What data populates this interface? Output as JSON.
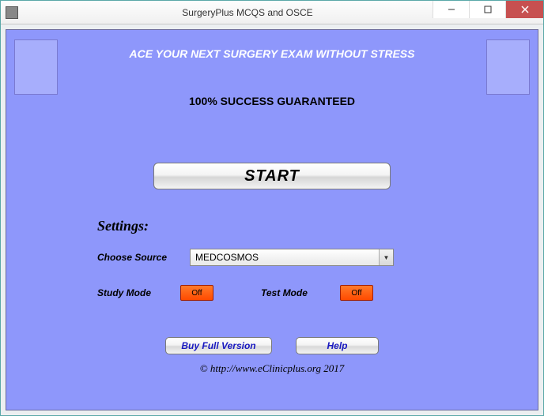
{
  "window": {
    "title": "SurgeryPlus MCQS and OSCE"
  },
  "header": {
    "tagline": "ACE YOUR NEXT SURGERY EXAM WITHOUT STRESS",
    "subhead": "100%  SUCCESS GUARANTEED"
  },
  "actions": {
    "start": "START",
    "buy": "Buy Full Version",
    "help": "Help"
  },
  "settings": {
    "heading": "Settings:",
    "source_label": "Choose Source",
    "source_value": "MEDCOSMOS",
    "study_label": "Study Mode",
    "study_value": "Off",
    "test_label": "Test Mode",
    "test_value": "Off"
  },
  "footer": {
    "text": "© http://www.eClinicplus.org 2017"
  },
  "colors": {
    "app_background": "#8e97fb",
    "toggle_off": "#ff5414",
    "link_text": "#1818c0"
  }
}
